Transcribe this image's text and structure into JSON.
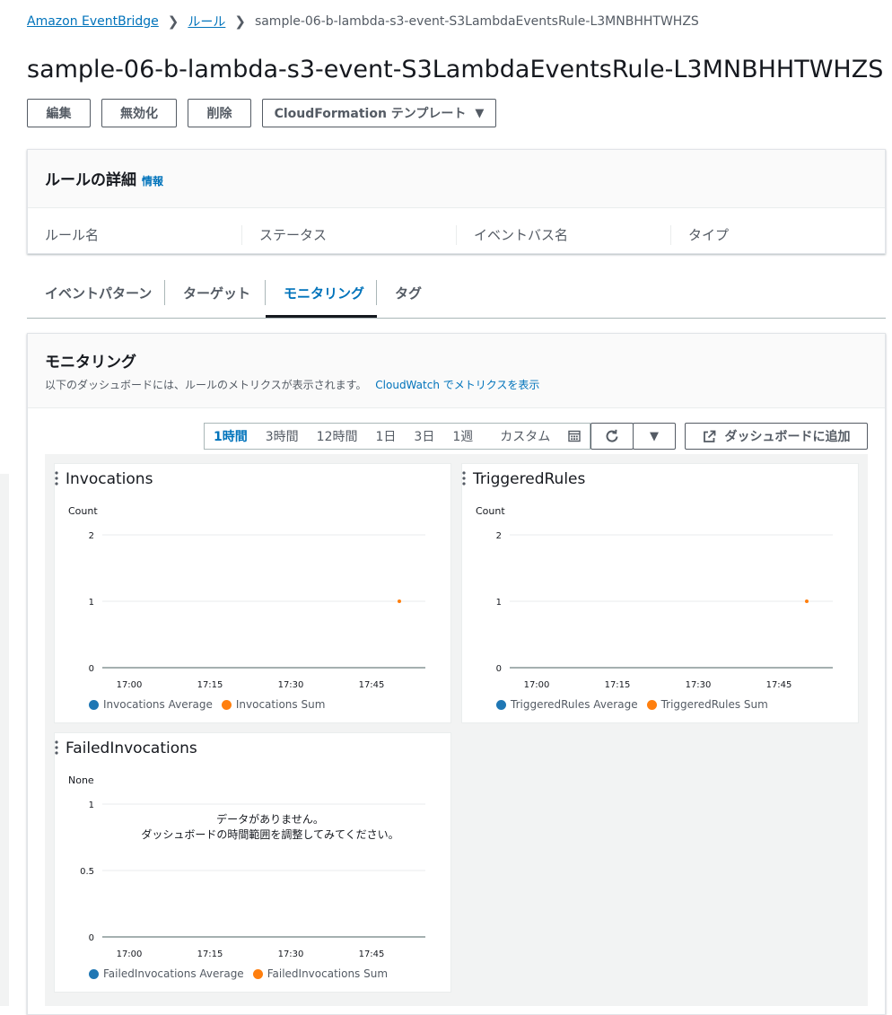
{
  "breadcrumb": {
    "home": "Amazon EventBridge",
    "rules": "ルール",
    "current": "sample-06-b-lambda-s3-event-S3LambdaEventsRule-L3MNBHHTWHZS"
  },
  "title": "sample-06-b-lambda-s3-event-S3LambdaEventsRule-L3MNBHHTWHZS",
  "actions": {
    "edit": "編集",
    "disable": "無効化",
    "delete": "削除",
    "cloudformation": "CloudFormation テンプレート"
  },
  "details": {
    "heading": "ルールの詳細",
    "info": "情報",
    "labels": [
      "ルール名",
      "ステータス",
      "イベントバス名",
      "タイプ"
    ]
  },
  "tabs": [
    "イベントパターン",
    "ターゲット",
    "モニタリング",
    "タグ"
  ],
  "active_tab": "モニタリング",
  "monitoring": {
    "heading": "モニタリング",
    "desc": "以下のダッシュボードには、ルールのメトリクスが表示されます。",
    "link": "CloudWatch でメトリクスを表示"
  },
  "time_ranges": [
    "1時間",
    "3時間",
    "12時間",
    "1日",
    "3日",
    "1週",
    "カスタム"
  ],
  "selected_range": "1時間",
  "add_dashboard": "ダッシュボードに追加",
  "icons": {
    "refresh": "refresh-icon",
    "dropdown": "caret-down-icon",
    "external": "external-link-icon",
    "calendar": "calendar-icon",
    "menu": "vertical-dots-icon"
  },
  "colors": {
    "link": "#0073bb",
    "series_average": "#1f77b4",
    "series_sum": "#ff7f0e"
  },
  "widgets": [
    {
      "title": "Invocations",
      "unit": "Count",
      "yticks": [
        "2",
        "1",
        "0"
      ],
      "xticks": [
        "17:00",
        "17:15",
        "17:30",
        "17:45"
      ],
      "legend": [
        "Invocations Average",
        "Invocations Sum"
      ]
    },
    {
      "title": "TriggeredRules",
      "unit": "Count",
      "yticks": [
        "2",
        "1",
        "0"
      ],
      "xticks": [
        "17:00",
        "17:15",
        "17:30",
        "17:45"
      ],
      "legend": [
        "TriggeredRules Average",
        "TriggeredRules Sum"
      ]
    },
    {
      "title": "FailedInvocations",
      "unit": "None",
      "yticks": [
        "1",
        "0.5",
        "0"
      ],
      "xticks": [
        "17:00",
        "17:15",
        "17:30",
        "17:45"
      ],
      "legend": [
        "FailedInvocations Average",
        "FailedInvocations Sum"
      ],
      "no_data_line1": "データがありません。",
      "no_data_line2": "ダッシュボードの時間範囲を調整してみてください。"
    }
  ],
  "chart_data": [
    {
      "type": "line",
      "title": "Invocations",
      "ylabel": "Count",
      "ylim": [
        0,
        2
      ],
      "x": [
        "17:00",
        "17:15",
        "17:30",
        "17:45"
      ],
      "series": [
        {
          "name": "Invocations Average",
          "points": []
        },
        {
          "name": "Invocations Sum",
          "points": [
            {
              "x": "17:52",
              "y": 1
            }
          ]
        }
      ],
      "grid": true,
      "legend": "bottom"
    },
    {
      "type": "line",
      "title": "TriggeredRules",
      "ylabel": "Count",
      "ylim": [
        0,
        2
      ],
      "x": [
        "17:00",
        "17:15",
        "17:30",
        "17:45"
      ],
      "series": [
        {
          "name": "TriggeredRules Average",
          "points": []
        },
        {
          "name": "TriggeredRules Sum",
          "points": [
            {
              "x": "17:52",
              "y": 1
            }
          ]
        }
      ],
      "grid": true,
      "legend": "bottom"
    },
    {
      "type": "line",
      "title": "FailedInvocations",
      "ylabel": "None",
      "ylim": [
        0,
        1
      ],
      "x": [
        "17:00",
        "17:15",
        "17:30",
        "17:45"
      ],
      "series": [
        {
          "name": "FailedInvocations Average",
          "points": []
        },
        {
          "name": "FailedInvocations Sum",
          "points": []
        }
      ],
      "grid": true,
      "legend": "bottom"
    }
  ]
}
